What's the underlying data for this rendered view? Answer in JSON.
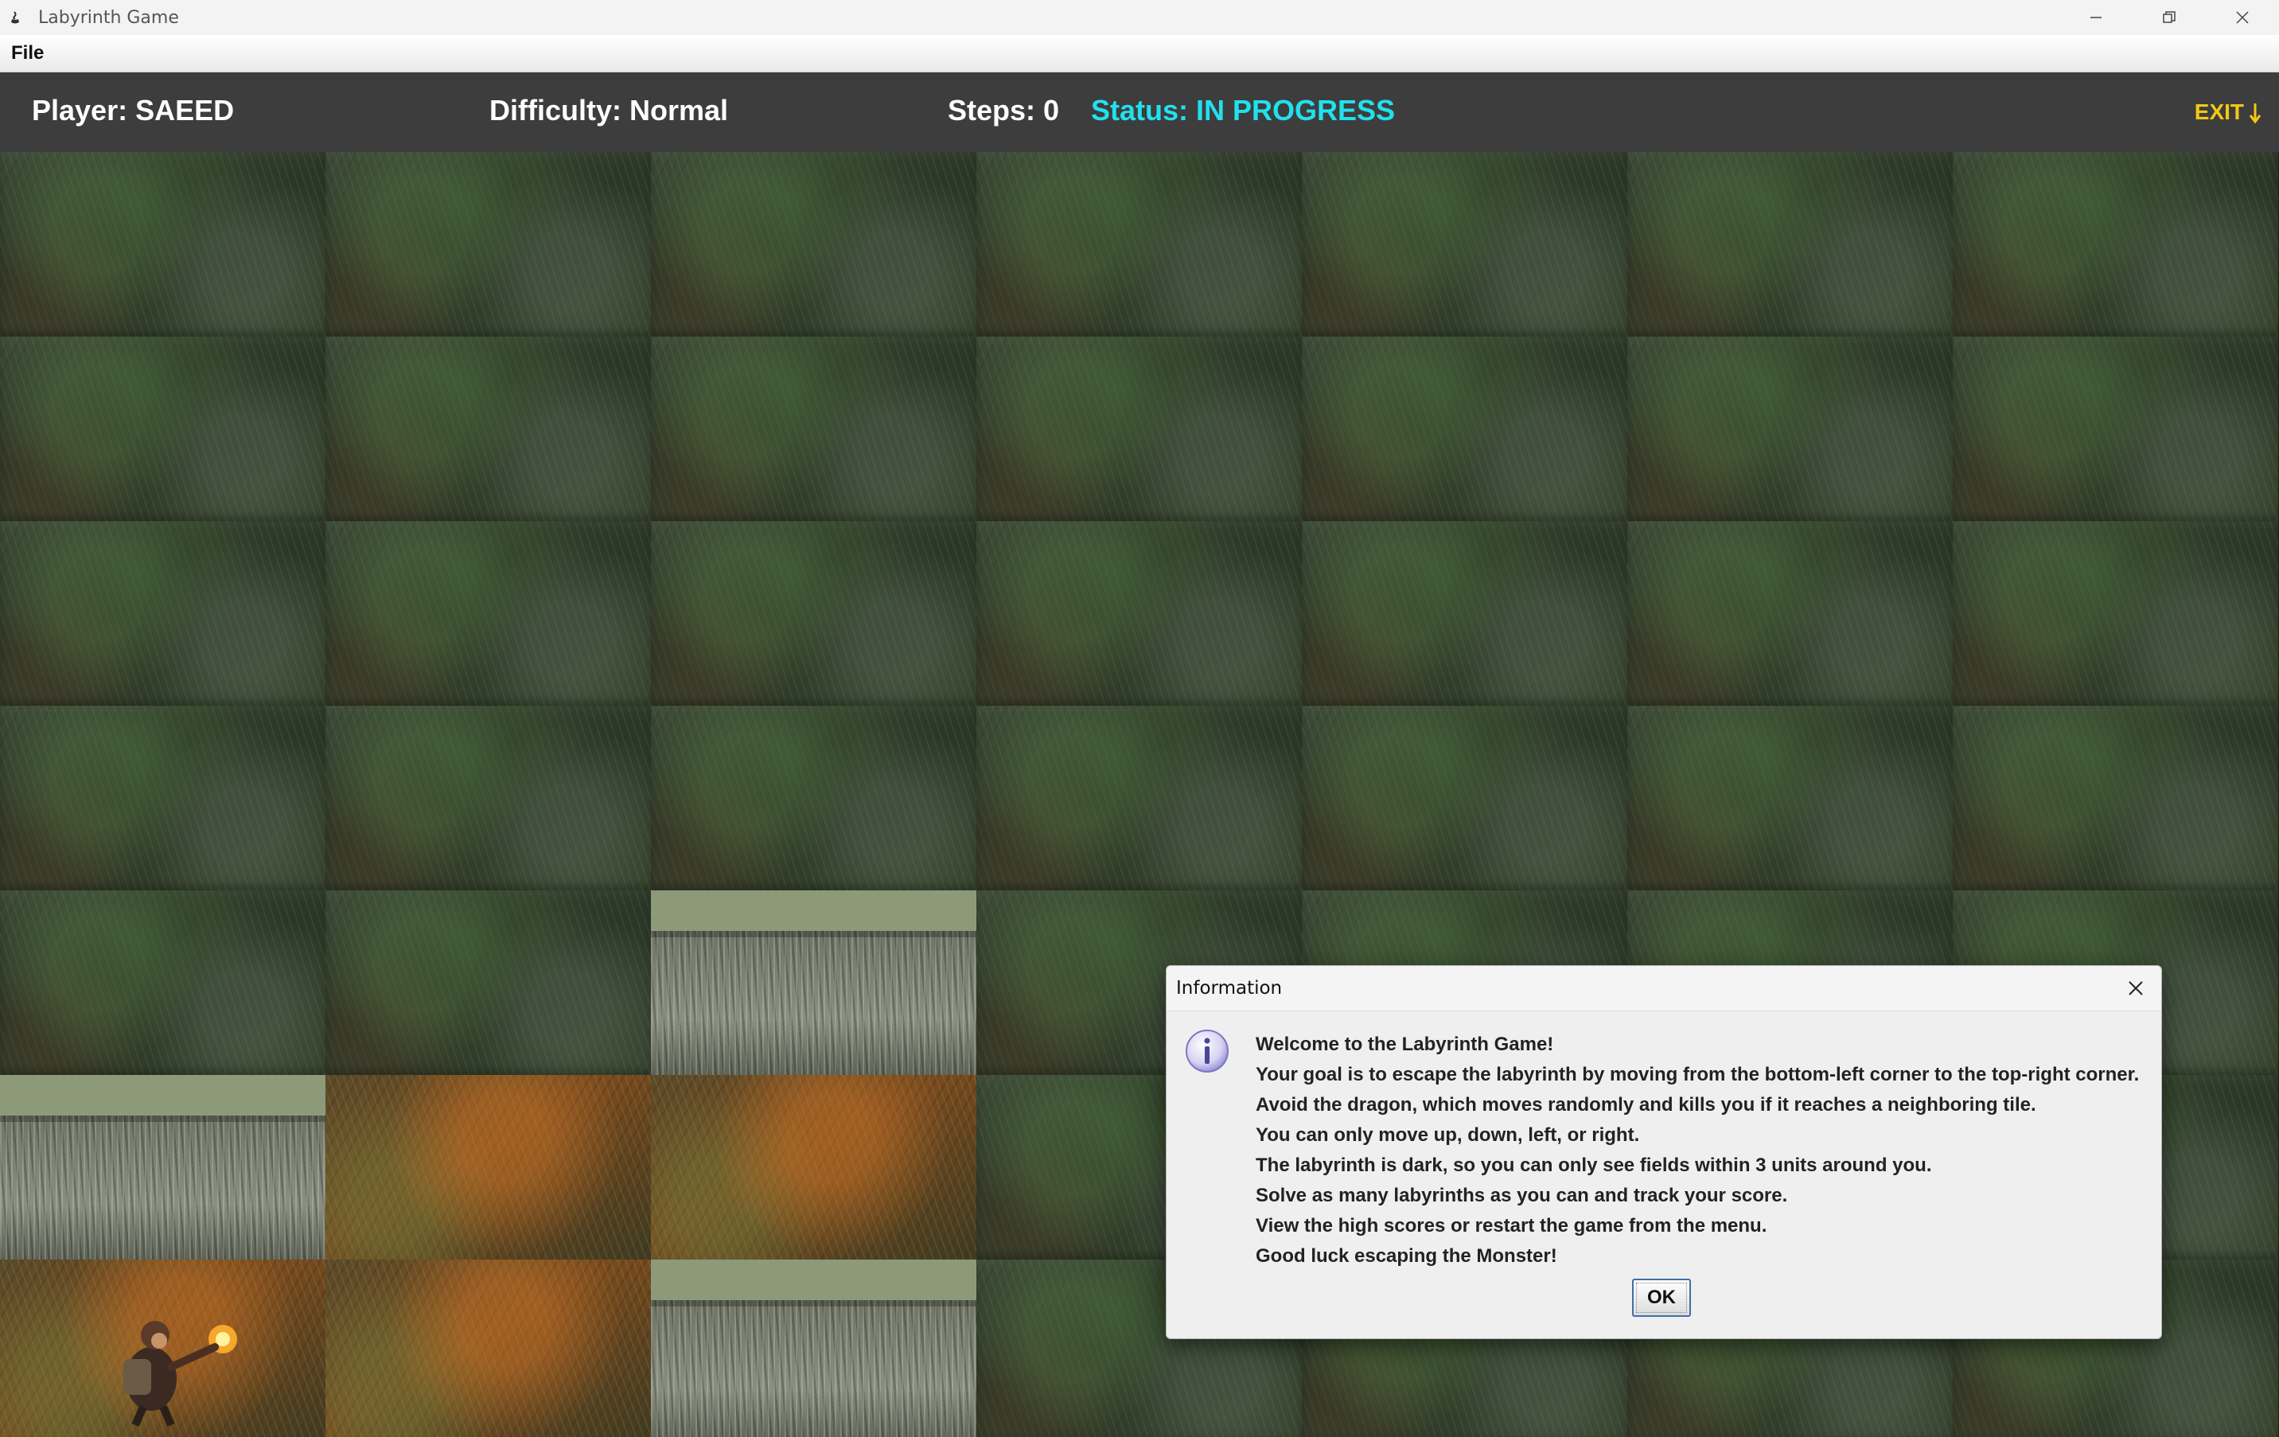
{
  "window": {
    "title": "Labyrinth Game",
    "controls": [
      "minimize-icon",
      "restore-icon",
      "close-icon"
    ]
  },
  "menu": {
    "items": [
      "File"
    ]
  },
  "status": {
    "player": "Player: SAEED",
    "difficulty": "Difficulty: Normal",
    "steps": "Steps: 0",
    "state": "Status: IN PROGRESS",
    "exit_label": "EXIT"
  },
  "colors": {
    "status_bar_bg": "#3d3d3d",
    "status_text": "#22e0ee",
    "exit_text": "#f3c814"
  },
  "grid": {
    "rows": 7,
    "cols": 7,
    "cells": [
      [
        "grass",
        "grass",
        "grass",
        "grass",
        "grass",
        "grass",
        "grass"
      ],
      [
        "grass",
        "grass",
        "grass",
        "grass",
        "grass",
        "grass",
        "grass"
      ],
      [
        "grass",
        "grass",
        "grass",
        "grass",
        "grass",
        "grass",
        "grass"
      ],
      [
        "grass",
        "grass",
        "grass",
        "grass",
        "grass",
        "grass",
        "grass"
      ],
      [
        "grass",
        "grass",
        "wall",
        "grass",
        "grass",
        "grass",
        "grass"
      ],
      [
        "wall",
        "lit",
        "lit",
        "grass",
        "grass",
        "grass",
        "grass"
      ],
      [
        "player",
        "lit",
        "wall",
        "grass",
        "grass",
        "grass",
        "grass"
      ]
    ]
  },
  "dialog": {
    "title": "Information",
    "icon": "info-icon",
    "lines": [
      "Welcome to the Labyrinth Game!",
      "Your goal is to escape the labyrinth by moving from the bottom-left corner to the top-right corner.",
      "Avoid the dragon, which moves randomly and kills you if it reaches a neighboring tile.",
      "You can only move up, down, left, or right.",
      "The labyrinth is dark, so you can only see fields within 3 units around you.",
      "Solve as many labyrinths as you can and track your score.",
      "View the high scores or restart the game from the menu.",
      "Good luck escaping the Monster!"
    ],
    "ok_label": "OK"
  }
}
